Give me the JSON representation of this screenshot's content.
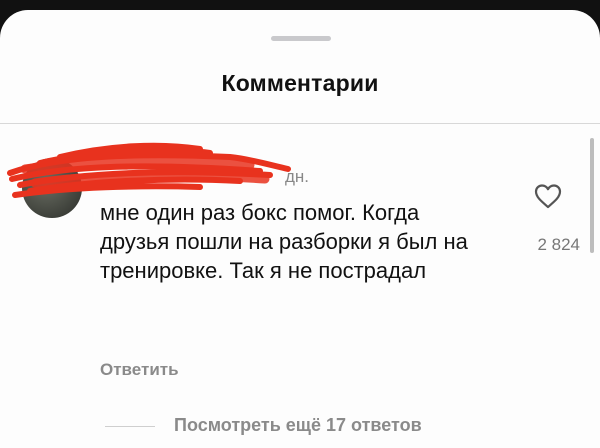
{
  "sheet": {
    "title": "Комментарии"
  },
  "comment": {
    "time": "дн.",
    "text": "мне один раз бокс помог. Когда друзья пошли на разборки я был на тренировке. Так я не пострадал",
    "likes": "2 824",
    "reply_label": "Ответить",
    "view_replies_label": "Посмотреть ещё 17 ответов"
  },
  "colors": {
    "redaction": "#e8321e",
    "background": "#fdfdfd",
    "muted_text": "#8a8a8a"
  },
  "icons": {
    "like": "heart-outline-icon"
  }
}
